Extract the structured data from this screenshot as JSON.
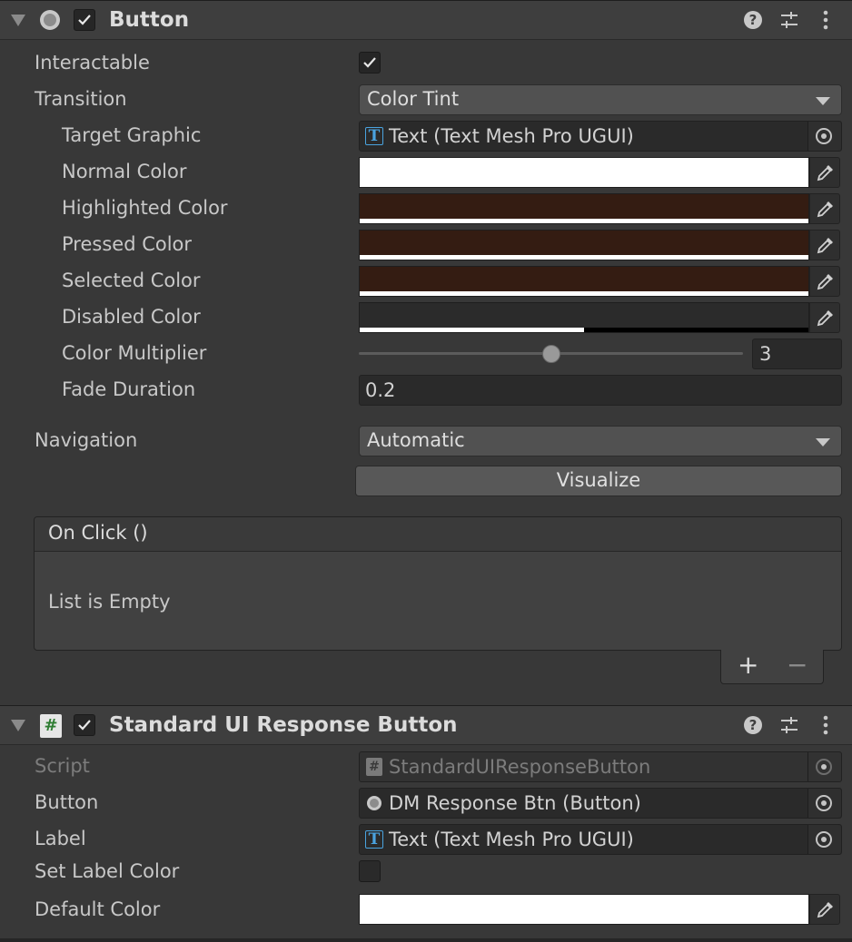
{
  "button_component": {
    "title": "Button",
    "enabled": true,
    "fields": {
      "interactable_label": "Interactable",
      "interactable_checked": true,
      "transition_label": "Transition",
      "transition_value": "Color Tint",
      "target_graphic_label": "Target Graphic",
      "target_graphic_value": "Text (Text Mesh Pro UGUI)",
      "normal_color_label": "Normal Color",
      "normal_color": "#ffffff",
      "highlighted_color_label": "Highlighted Color",
      "highlighted_color": "#341c12",
      "pressed_color_label": "Pressed Color",
      "pressed_color": "#341c12",
      "selected_color_label": "Selected Color",
      "selected_color": "#341c12",
      "disabled_color_label": "Disabled Color",
      "disabled_color": "#2b2b2b",
      "disabled_alpha": 0.5,
      "color_multiplier_label": "Color Multiplier",
      "color_multiplier_value": "3",
      "color_multiplier_slider_fraction": 0.5,
      "fade_duration_label": "Fade Duration",
      "fade_duration_value": "0.2",
      "navigation_label": "Navigation",
      "navigation_value": "Automatic",
      "visualize_label": "Visualize"
    },
    "on_click": {
      "header": "On Click ()",
      "empty_text": "List is Empty",
      "add_label": "+",
      "remove_label": "−"
    }
  },
  "response_component": {
    "title": "Standard UI Response Button",
    "enabled": true,
    "icon_glyph": "#",
    "fields": {
      "script_label": "Script",
      "script_value": "StandardUIResponseButton",
      "button_label": "Button",
      "button_value": "DM Response Btn (Button)",
      "label_label": "Label",
      "label_value": "Text (Text Mesh Pro UGUI)",
      "set_label_color_label": "Set Label Color",
      "set_label_color_checked": false,
      "default_color_label": "Default Color",
      "default_color": "#ffffff"
    }
  },
  "icons": {
    "help": "help-icon",
    "presets": "presets-icon",
    "menu": "kebab-menu-icon",
    "object_picker": "object-picker-icon",
    "eyedropper": "eyedropper-icon",
    "tmp_text": "tmp-text-icon",
    "script": "script-icon",
    "button_component": "button-component-icon"
  }
}
